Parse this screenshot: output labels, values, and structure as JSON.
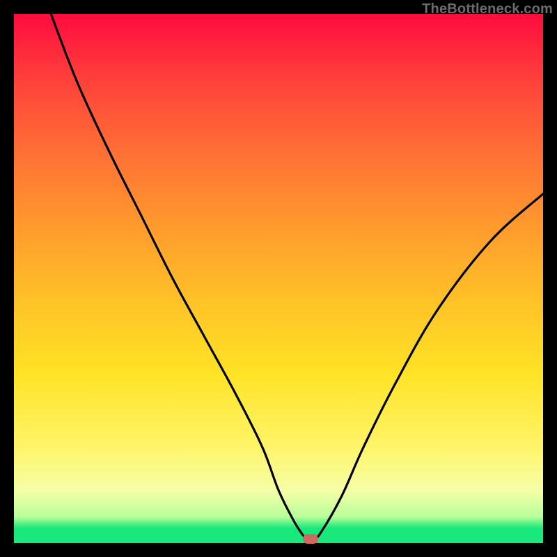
{
  "watermark": "TheBottleneck.com",
  "colors": {
    "frame": "#000000",
    "gradient_top": "#ff0b3e",
    "gradient_mid": "#ffe326",
    "gradient_bottom": "#19e87a",
    "curve": "#000000",
    "marker": "#cf6b5e"
  },
  "chart_data": {
    "type": "line",
    "title": "",
    "xlabel": "",
    "ylabel": "",
    "xlim": [
      0,
      100
    ],
    "ylim": [
      0,
      100
    ],
    "grid": false,
    "legend": false,
    "series": [
      {
        "name": "bottleneck-curve",
        "x": [
          7,
          12,
          18,
          24,
          30,
          36,
          42,
          47,
          50,
          53,
          55,
          56,
          58,
          62,
          66,
          72,
          80,
          90,
          100
        ],
        "y": [
          100,
          87,
          74,
          62,
          50,
          39,
          28,
          18,
          10,
          4,
          1,
          0,
          2,
          9,
          18,
          30,
          44,
          57,
          66
        ]
      }
    ],
    "marker": {
      "x": 56,
      "y": 0
    },
    "background_gradient": {
      "stops": [
        {
          "pos": 0.0,
          "color": "#ff0b3e"
        },
        {
          "pos": 0.12,
          "color": "#ff3f3b"
        },
        {
          "pos": 0.26,
          "color": "#ff6f35"
        },
        {
          "pos": 0.4,
          "color": "#ff9a2d"
        },
        {
          "pos": 0.55,
          "color": "#ffc427"
        },
        {
          "pos": 0.68,
          "color": "#ffe326"
        },
        {
          "pos": 0.82,
          "color": "#fff56a"
        },
        {
          "pos": 0.9,
          "color": "#f6ffa8"
        },
        {
          "pos": 0.95,
          "color": "#b8ff9a"
        },
        {
          "pos": 0.972,
          "color": "#19e87a"
        },
        {
          "pos": 1.0,
          "color": "#19e87a"
        }
      ]
    }
  }
}
